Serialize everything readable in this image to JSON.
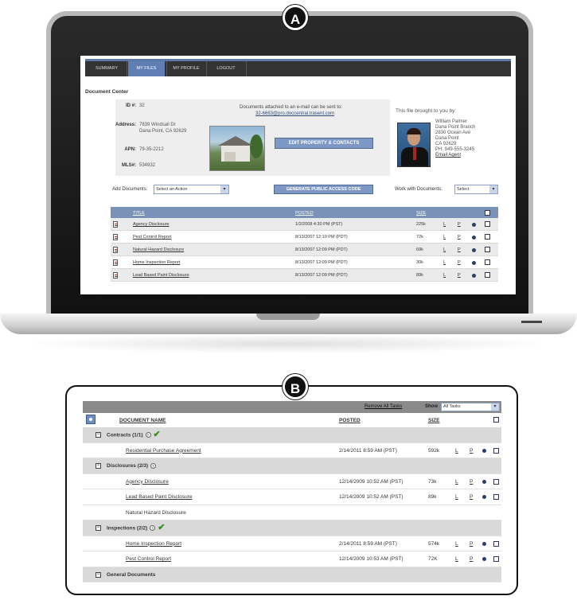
{
  "labels": {
    "a": "A",
    "b": "B"
  },
  "portal": {
    "nav_tabs": [
      "SUMMARY",
      "MY FILES",
      "MY PROFILE",
      "LOGOUT"
    ],
    "active_tab": "MY FILES",
    "section_title": "Document Center",
    "property": {
      "id_label": "ID #:",
      "id_value": "32",
      "address_label": "Address:",
      "address_line1": "7839 Windsail Dr",
      "address_line2": "Dana Point, CA 92629",
      "apn_label": "APN:",
      "apn_value": "79-35-2212",
      "mls_label": "MLS#:",
      "mls_value": "534932"
    },
    "email_note": "Documents attached to an e-mail can be sent to:",
    "email_address": "32-6663@pro.doccentral.trasent.com",
    "edit_button": "EDIT PROPERTY & CONTACTS",
    "agent": {
      "heading": "This file brought to you by:",
      "name": "William Palmer",
      "office": "Dana Point Branch",
      "street": "2830 Ocean Ave",
      "city": "Dana Point",
      "zip": "CA 92629",
      "phone": "PH: 949-555-3245",
      "email_link": "Email Agent"
    },
    "add_documents_label": "Add Documents:",
    "add_documents_select": "Select an Action",
    "generate_button": "GENERATE PUBLIC ACCESS CODE",
    "work_with_label": "Work with Documents:",
    "work_with_select": "Select",
    "table_headers": {
      "title": "TITLE",
      "posted": "POSTED",
      "size": "SIZE"
    },
    "documents": [
      {
        "title": "Agency Disclosure",
        "posted": "1/2/2008 4:30 PM (PST)",
        "size": "225k"
      },
      {
        "title": "Pest Control Report",
        "posted": "8/13/2007 12:10 PM (PDT)",
        "size": "72k"
      },
      {
        "title": "Natural Hazard Disclosure",
        "posted": "8/13/2007 12:09 PM (PDT)",
        "size": "69k"
      },
      {
        "title": "Home Inspection Report",
        "posted": "8/13/2007 12:09 PM (PDT)",
        "size": "30k"
      },
      {
        "title": "Lead Based Paint Disclosure",
        "posted": "8/13/2007 12:09 PM (PDT)",
        "size": "89k"
      }
    ],
    "row_actions": {
      "l": "L",
      "p": "P"
    }
  },
  "tasks": {
    "remove_all": "Remove All Tasks",
    "show_label": "Show",
    "show_select": "All Tasks",
    "headers": {
      "name": "DOCUMENT NAME",
      "posted": "POSTED",
      "size": "SIZE"
    },
    "groups": [
      {
        "name": "Contracts (1/1)",
        "complete": true,
        "items": [
          {
            "name": "Residential Purchase Agreement",
            "posted": "2/14/2011 8:59 AM (PST)",
            "size": "592k",
            "has_file": true
          }
        ]
      },
      {
        "name": "Disclosures (2/3)",
        "complete": false,
        "items": [
          {
            "name": "Agency Disclosure",
            "posted": "12/14/2009 10:52 AM (PST)",
            "size": "73k",
            "has_file": true
          },
          {
            "name": "Lead Based Paint Disclosure",
            "posted": "12/14/2009 10:52 AM (PST)",
            "size": "89k",
            "has_file": true
          },
          {
            "name": "Natural Hazard Disclosure",
            "posted": "",
            "size": "",
            "has_file": false
          }
        ]
      },
      {
        "name": "Inspections (2/2)",
        "complete": true,
        "items": [
          {
            "name": "Home Inspection Report",
            "posted": "2/14/2011 8:59 AM (PST)",
            "size": "574k",
            "has_file": true
          },
          {
            "name": "Pest Control Report",
            "posted": "12/14/2009 10:53 AM (PST)",
            "size": "72K",
            "has_file": true
          }
        ]
      },
      {
        "name": "General Documents",
        "complete": false,
        "items": []
      }
    ],
    "row_actions": {
      "l": "L",
      "p": "P"
    }
  },
  "colors": {
    "accent": "#7a92b8",
    "nav": "#333333",
    "check": "#3a8a1e"
  }
}
